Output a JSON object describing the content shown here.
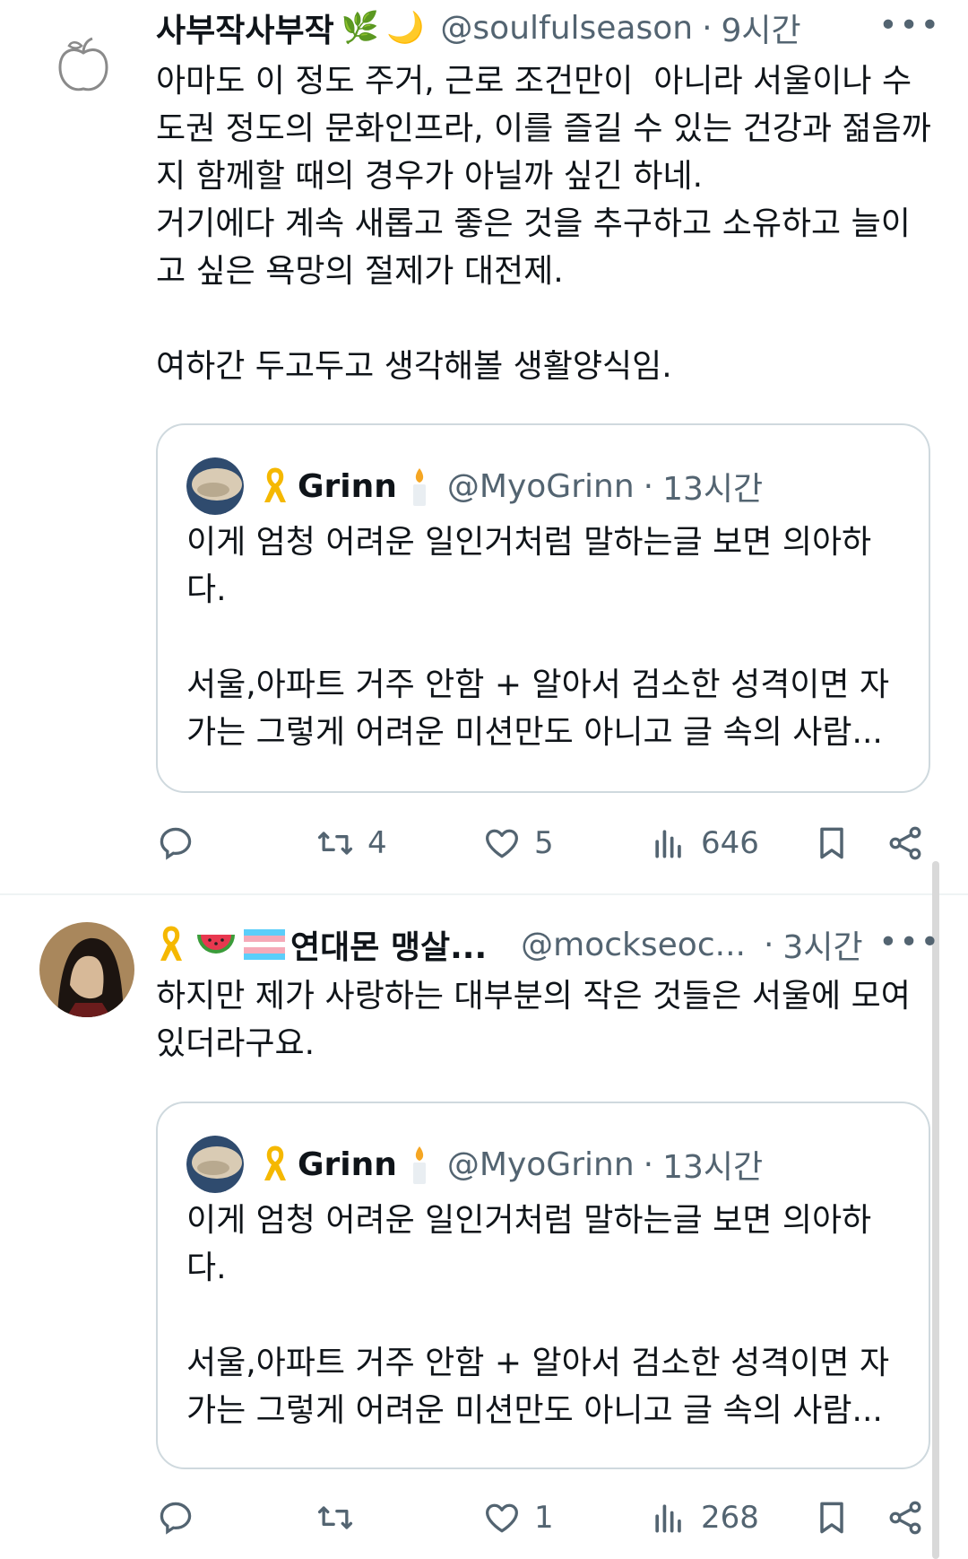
{
  "tweets": [
    {
      "name": "사부작사부작",
      "name_emojis": [
        "🌿",
        "🌙"
      ],
      "handle": "@soulfulseason",
      "time": "9시간",
      "more": "•••",
      "text": "아마도 이 정도 주거, 근로 조건만이  아니라 서울이나 수\n도권 정도의 문화인프라, 이를 즐길 수 있는 건강과 젊음까\n지 함께할 때의 경우가 아닐까 싶긴 하네.\n거기에다 계속 새롭고 좋은 것을 추구하고 소유하고 늘이\n고 싶은 욕망의 절제가 대전제.\n\n여하간 두고두고 생각해볼 생활양식임.",
      "quote": {
        "name": "Grinn",
        "handle": "@MyoGrinn",
        "time": "13시간",
        "text": "이게 엄청 어려운 일인거처럼 말하는글 보면 의아하\n다.\n\n서울,아파트 거주 안함 + 알아서 검소한 성격이면 자\n가는 그렇게 어려운 미션만도 아니고 글 속의 사람..."
      },
      "stats": {
        "replies": "",
        "retweets": "4",
        "likes": "5",
        "views": "646"
      }
    },
    {
      "name": "연대몬 맹살...",
      "handle": "@mockseoc...",
      "time": "3시간",
      "more": "•••",
      "text": "하지만 제가 사랑하는 대부분의 작은 것들은 서울에 모여\n있더라구요.",
      "quote": {
        "name": "Grinn",
        "handle": "@MyoGrinn",
        "time": "13시간",
        "text": "이게 엄청 어려운 일인거처럼 말하는글 보면 의아하\n다.\n\n서울,아파트 거주 안함 + 알아서 검소한 성격이면 자\n가는 그렇게 어려운 미션만도 아니고 글 속의 사람..."
      },
      "stats": {
        "replies": "",
        "retweets": "",
        "likes": "1",
        "views": "268"
      }
    }
  ],
  "colors": {
    "text": "#0f1419",
    "secondary": "#536471",
    "border": "#cfd9de",
    "ribbon": "#f5b800"
  }
}
